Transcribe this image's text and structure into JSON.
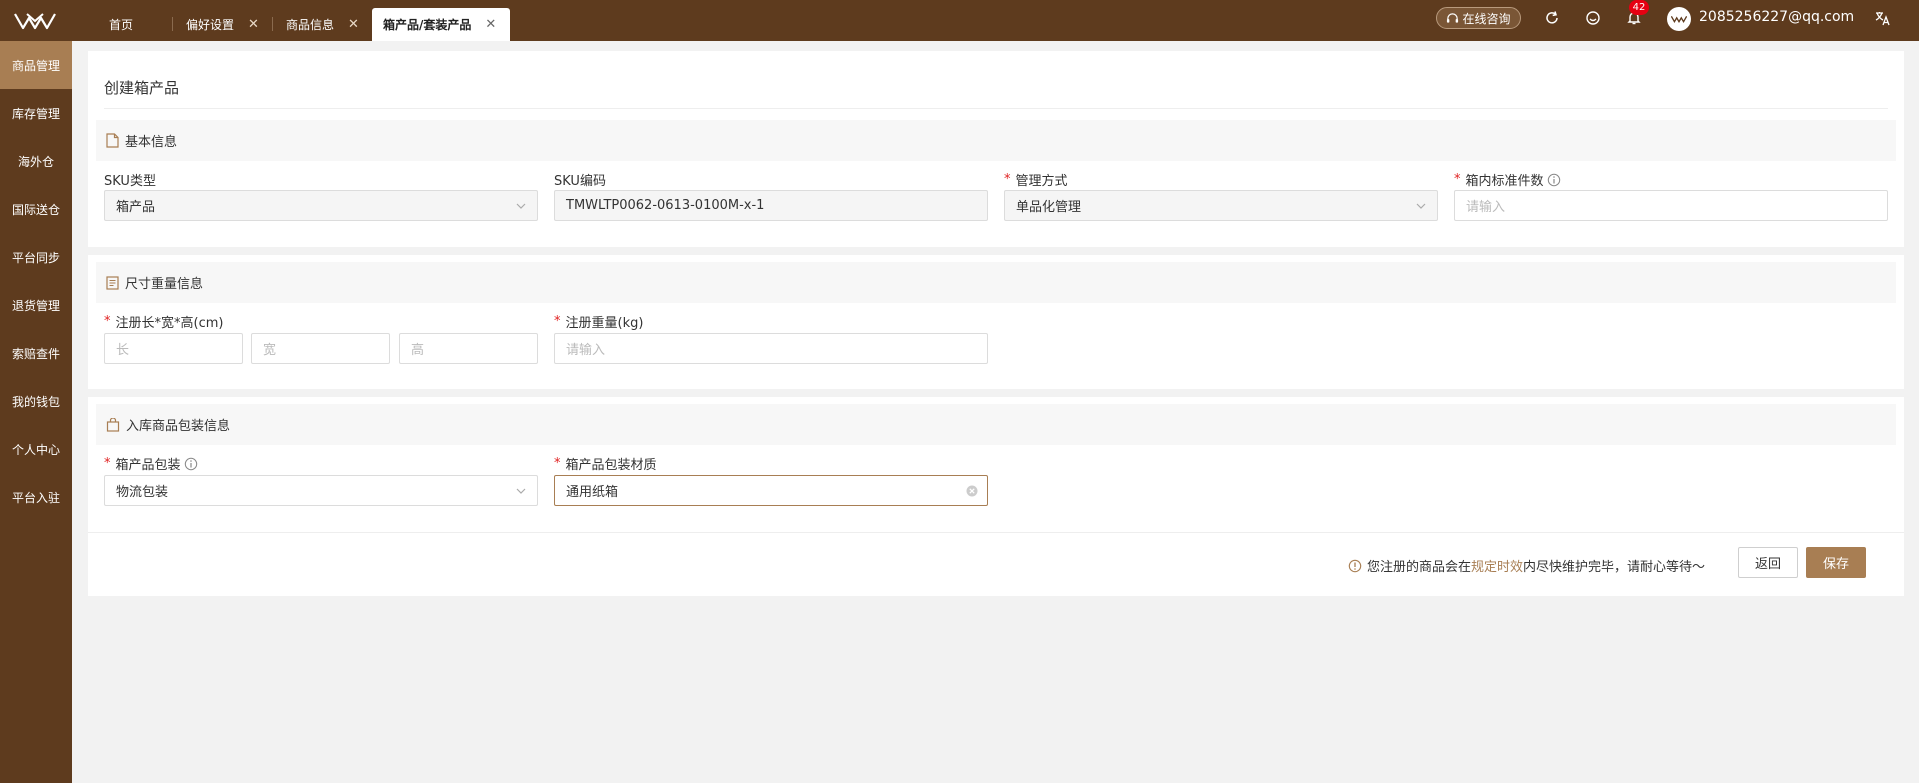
{
  "colors": {
    "brand_dark": "#5e3b1e",
    "accent": "#a87e53",
    "required": "#e02020",
    "badge": "#e60012"
  },
  "topbar": {
    "tabs": [
      {
        "label": "首页",
        "closable": false,
        "active": false
      },
      {
        "label": "偏好设置",
        "closable": true,
        "active": false
      },
      {
        "label": "商品信息",
        "closable": true,
        "active": false
      },
      {
        "label": "箱产品/套装产品",
        "closable": true,
        "active": true
      }
    ],
    "consult_label": "在线咨询",
    "notification_count": "42",
    "user_email": "2085256227@qq.com",
    "icons": [
      "logo-icon",
      "headset-icon",
      "refresh-icon",
      "feedback-icon",
      "bell-icon",
      "translate-icon"
    ]
  },
  "sidebar": {
    "items": [
      {
        "label": "商品管理",
        "active": true
      },
      {
        "label": "库存管理",
        "active": false
      },
      {
        "label": "海外仓",
        "active": false
      },
      {
        "label": "国际送仓",
        "active": false
      },
      {
        "label": "平台同步",
        "active": false
      },
      {
        "label": "退货管理",
        "active": false
      },
      {
        "label": "索赔查件",
        "active": false
      },
      {
        "label": "我的钱包",
        "active": false
      },
      {
        "label": "个人中心",
        "active": false
      },
      {
        "label": "平台入驻",
        "active": false
      }
    ]
  },
  "form": {
    "page_title": "创建箱产品",
    "basic": {
      "section_title": "基本信息",
      "sku_type_label": "SKU类型",
      "sku_type_value": "箱产品",
      "sku_code_label": "SKU编码",
      "sku_code_value": "TMWLTP0062-0613-0100M-x-1",
      "manage_label": "管理方式",
      "manage_value": "单品化管理",
      "std_qty_label": "箱内标准件数",
      "std_qty_placeholder": "请输入"
    },
    "dimension": {
      "section_title": "尺寸重量信息",
      "size_label": "注册长*宽*高(cm)",
      "length_placeholder": "长",
      "width_placeholder": "宽",
      "height_placeholder": "高",
      "weight_label": "注册重量(kg)",
      "weight_placeholder": "请输入"
    },
    "packaging": {
      "section_title": "入库商品包装信息",
      "pack_label": "箱产品包装",
      "pack_value": "物流包装",
      "material_label": "箱产品包装材质",
      "material_value": "通用纸箱"
    }
  },
  "footer": {
    "notice_prefix": "您注册的商品会在",
    "notice_link": "规定时效",
    "notice_suffix": "内尽快维护完毕，请耐心等待～",
    "back_label": "返回",
    "save_label": "保存"
  }
}
